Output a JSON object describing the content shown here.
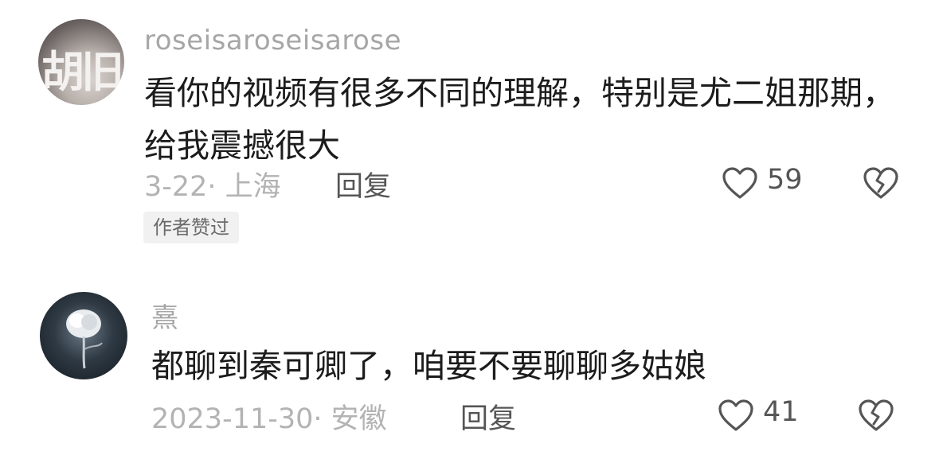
{
  "comments": [
    {
      "username": "roseisaroseisarose",
      "avatar_text": "胡旧",
      "content": "看你的视频有很多不同的理解，特别是尤二姐那期，给我震撼很大",
      "meta": "3-22· 上海",
      "reply_label": "回复",
      "like_count": "59",
      "author_liked_badge": "作者赞过"
    },
    {
      "username": "熹",
      "content": "都聊到秦可卿了，咱要不要聊聊多姑娘",
      "meta": "2023-11-30· 安徽",
      "reply_label": "回复",
      "like_count": "41"
    }
  ],
  "icons": {
    "like": "heart-outline-icon",
    "dislike": "broken-heart-icon"
  },
  "colors": {
    "username": "#a6a6a6",
    "meta": "#b3b3b3",
    "badge_bg": "#f1f1f1"
  }
}
